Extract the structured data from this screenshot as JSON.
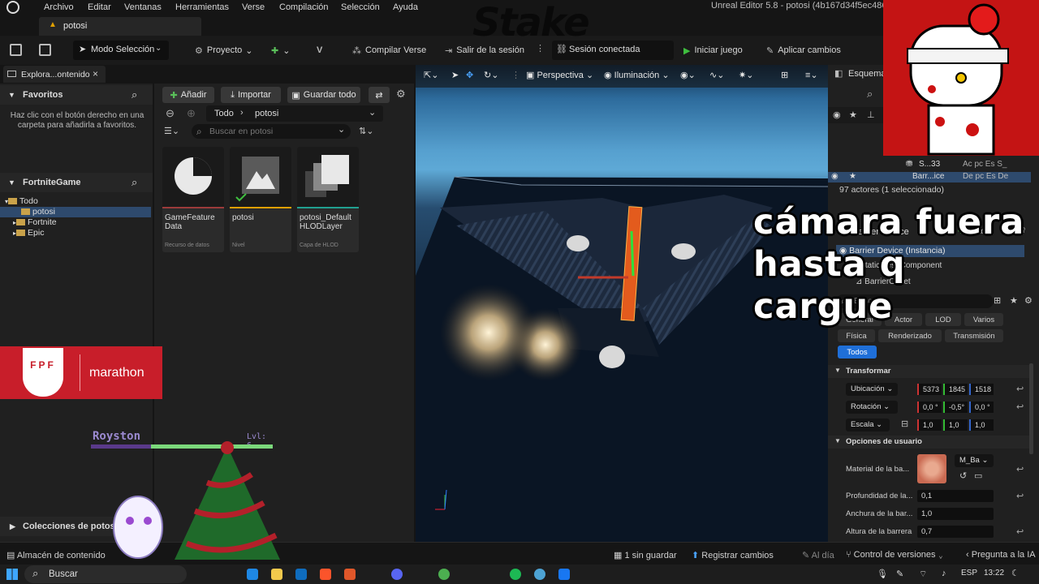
{
  "app": {
    "title": "Unreal Editor 5.8 - potosi",
    "title_suffix": "(4b167d34f5ec486a9",
    "menu": [
      "Archivo",
      "Editar",
      "Ventanas",
      "Herramientas",
      "Verse",
      "Compilación",
      "Selección",
      "Ayuda"
    ],
    "level_tab": "potosi"
  },
  "toolbar": {
    "mode": "Modo Selección",
    "project": "Proyecto",
    "compile_verse": "Compilar Verse",
    "exit_session": "Salir de la sesión",
    "session_status": "Sesión conectada",
    "start_game": "Iniciar juego",
    "apply_changes": "Aplicar cambios"
  },
  "content_browser": {
    "tab": "Explora...ontenido",
    "favorites_title": "Favoritos",
    "favorites_hint": "Haz clic con el botón derecho en una carpeta para añadirla a favoritos.",
    "project_title": "FortniteGame",
    "tree": [
      "Todo",
      "potosi",
      "Fortnite",
      "Epic"
    ],
    "add_button": "Añadir",
    "import_button": "Importar",
    "save_all_button": "Guardar todo",
    "path": [
      "Todo",
      "potosi"
    ],
    "search_placeholder": "Buscar en potosi",
    "assets": [
      {
        "name": "GameFeature Data",
        "kind": "Recurso de datos",
        "color": "#9b3b3b"
      },
      {
        "name": "potosi",
        "kind": "Nivel",
        "color": "#e0a000"
      },
      {
        "name": "potosi_Default HLODLayer",
        "kind": "Capa de HLOD",
        "color": "#21a090"
      }
    ],
    "collections": "Colecciones de potosi"
  },
  "viewport": {
    "perspective": "Perspectiva",
    "lighting": "Iluminación"
  },
  "outliner": {
    "tab": "Esquema",
    "rows": [
      {
        "name": "S...33",
        "cols": "Ac pc Es S_"
      },
      {
        "name": "Barr...ice",
        "cols": "De pc Es De"
      }
    ],
    "actors_count": "97 actores (1 seleccionado)"
  },
  "details": {
    "object_title": "Barrier Device",
    "add_label": "Añadir",
    "components": [
      "Barrier Device (Instancia)",
      "StaticMeshComponent",
      "BarrierOffset"
    ],
    "search_placeholder": "Buscar",
    "categories": [
      "General",
      "Actor",
      "LOD",
      "Varios",
      "Física",
      "Renderizado",
      "Transmisión",
      "Todos"
    ],
    "transform_title": "Transformar",
    "location_label": "Ubicación",
    "location": [
      "5373",
      "1845",
      "1518"
    ],
    "rotation_label": "Rotación",
    "rotation": [
      "0,0 °",
      "-0,5°",
      "0,0 °"
    ],
    "scale_label": "Escala",
    "scale": [
      "1,0",
      "1,0",
      "1,0"
    ],
    "user_options_title": "Opciones de usuario",
    "material_label": "Material de la ba...",
    "material_value": "M_Ba",
    "depth_label": "Profundidad de la...",
    "depth_value": "0,1",
    "width_label": "Anchura de la bar...",
    "width_value": "1,0",
    "height_label": "Altura de la barrera",
    "height_value": "0,7"
  },
  "statusbar": {
    "content_drawer": "Almacén de contenido",
    "unsaved": "1 sin guardar",
    "register_changes": "Registrar cambios",
    "up_to_date": "Al día",
    "version_control": "Control de versiones",
    "ask_ai": "Pregunta a la IA"
  },
  "taskbar": {
    "search": "Buscar",
    "language": "ESP",
    "time": "13:22"
  },
  "overlays": {
    "stream_caption": "cámara fuera\nhasta q cargue",
    "fpf_label": "FPF",
    "marathon": "marathon",
    "player_name": "Royston",
    "player_level": "Lvl: 6",
    "watermark": "Stake"
  }
}
